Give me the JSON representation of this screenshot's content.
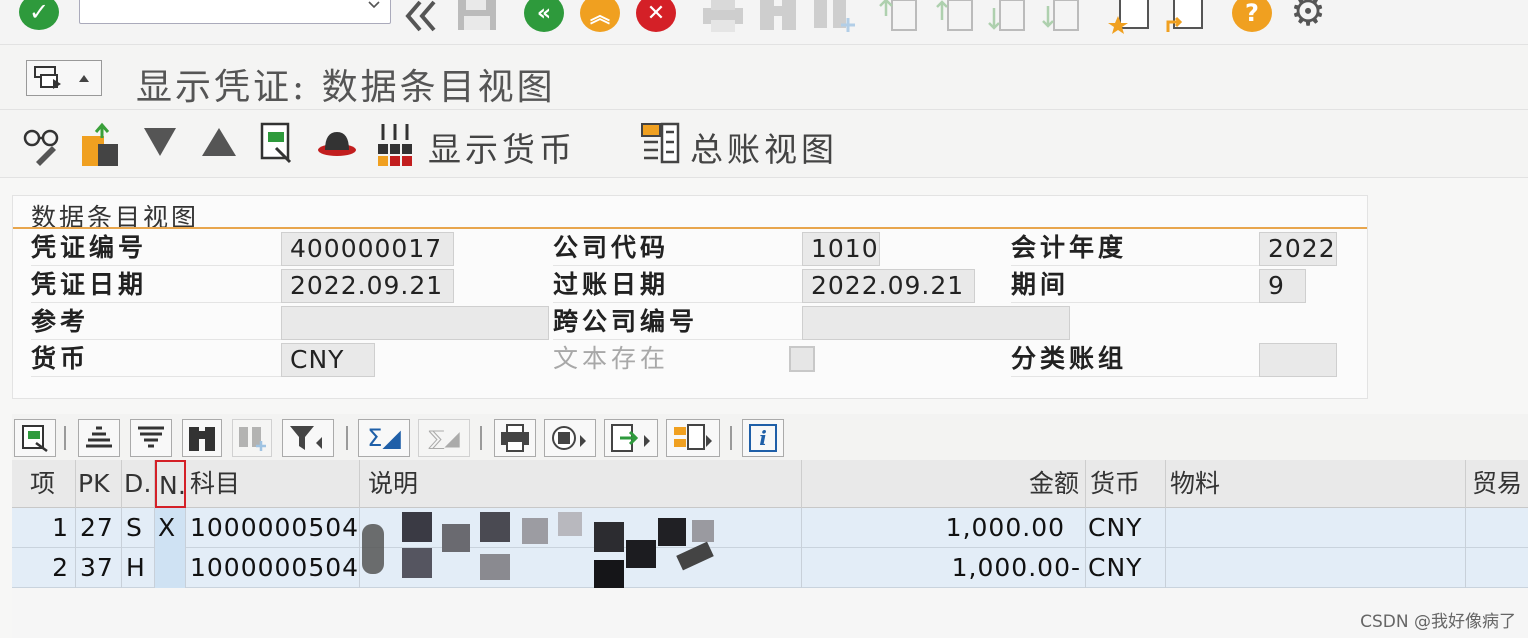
{
  "colors": {
    "accent": "#e8a64d",
    "green": "#2e9a3c",
    "orange": "#f0a020",
    "red": "#d42027",
    "selection": "#e3edf7"
  },
  "system_toolbar": {
    "icons": [
      "enter-check-icon",
      "command-field",
      "back-arrows-icon",
      "save-icon",
      "back-green-icon",
      "exit-orange-icon",
      "cancel-red-icon",
      "print-icon",
      "find-icon",
      "find-next-icon",
      "first-page-icon",
      "previous-page-icon",
      "next-page-icon",
      "last-page-icon",
      "create-session-icon",
      "shortcut-icon",
      "help-icon",
      "settings-icon"
    ]
  },
  "title": {
    "text": "显示凭证: 数据条目视图"
  },
  "app_toolbar": {
    "display_currency": "显示货币",
    "ledger_view": "总账视图"
  },
  "header": {
    "section_title": "数据条目视图",
    "fields": {
      "doc_number_label": "凭证编号",
      "doc_number": "400000017",
      "company_code_label": "公司代码",
      "company_code": "1010",
      "fiscal_year_label": "会计年度",
      "fiscal_year": "2022",
      "doc_date_label": "凭证日期",
      "doc_date": "2022.09.21",
      "posting_date_label": "过账日期",
      "posting_date": "2022.09.21",
      "period_label": "期间",
      "period": "9",
      "reference_label": "参考",
      "reference": "",
      "cross_company_label": "跨公司编号",
      "cross_company": "",
      "currency_label": "货币",
      "currency": "CNY",
      "text_exists_label": "文本存在",
      "ledger_group_label": "分类账组",
      "ledger_group": ""
    }
  },
  "grid": {
    "columns": [
      "项",
      "PK",
      "D…",
      "N…",
      "科目",
      "说明",
      "金额",
      "货币",
      "物料",
      "贸易"
    ],
    "rows": [
      {
        "item": "1",
        "pk": "27",
        "d": "S",
        "n": "X",
        "account": "1000000504",
        "desc": "",
        "amount": "1,000.00",
        "currency": "CNY"
      },
      {
        "item": "2",
        "pk": "37",
        "d": "H",
        "n": "",
        "account": "1000000504",
        "desc": "",
        "amount": "1,000.00-",
        "currency": "CNY"
      }
    ]
  },
  "watermark": "CSDN @我好像病了"
}
